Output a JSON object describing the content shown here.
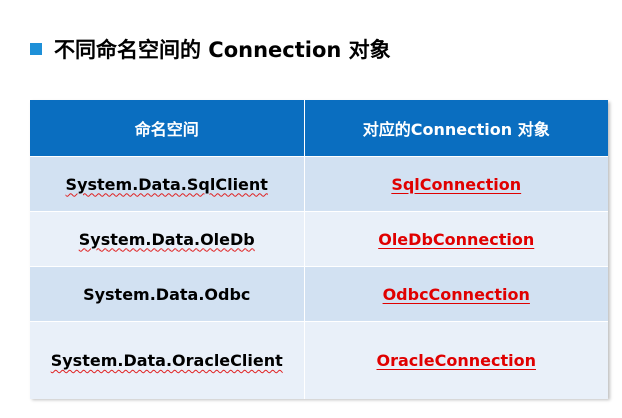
{
  "slide": {
    "title": "不同命名空间的 Connection 对象"
  },
  "table": {
    "headers": [
      "命名空间",
      "对应的Connection 对象"
    ],
    "rows": [
      {
        "namespace": "System.Data.SqlClient",
        "connection": "SqlConnection"
      },
      {
        "namespace": "System.Data.OleDb",
        "connection": "OleDbConnection"
      },
      {
        "namespace": "System.Data.Odbc",
        "connection": "OdbcConnection"
      },
      {
        "namespace": "System.Data.OracleClient",
        "connection": "OracleConnection"
      }
    ]
  },
  "colors": {
    "accent": "#1e90d8",
    "header_bg": "#0a6ec0",
    "row_odd": "#d2e1f2",
    "row_even": "#e9f0f9",
    "link_red": "#e00000"
  },
  "icons": {
    "bullet": "square-bullet-icon"
  }
}
